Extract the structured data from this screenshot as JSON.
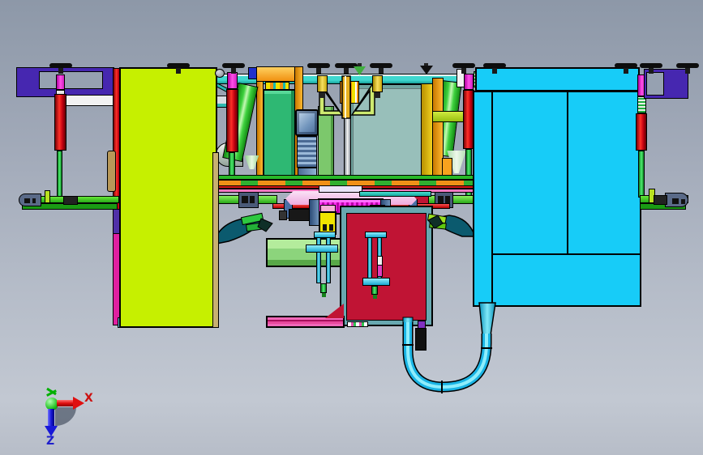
{
  "app": {
    "type": "cad-viewport",
    "view": "orthographic front view of a packaging / handling machine assembly"
  },
  "axis_triad": {
    "x_label": "X",
    "z_label": "Z"
  },
  "palette": {
    "bgTop": "#8d98a8",
    "bgBottom": "#c2c8d2",
    "notch": "#96a1b1",
    "chartreuse": "#c6f000",
    "cyan": "#17ccf8",
    "indigo": "#4627b0",
    "purpleStrip": "#5030a8",
    "magentaStrip": "#e020a0",
    "crimson": "#c01434",
    "tealPanel": "#98bfba",
    "tealFrame": "#68a8b0",
    "drumMagenta": "#e020d0",
    "red": "#e01018",
    "green": "#2eb873",
    "lightGreenPanel": "#7cc86c",
    "orange": "#f8a21e",
    "yellow": "#f0e400",
    "gold": "#d8c018",
    "gusset": "#cde96f",
    "slate": "#5a6a88",
    "steelBlue": "#6f93bb",
    "steelDark": "#4a6fa5",
    "pinkPlate": "#f2c4ea",
    "pinkRail": "#e8489c",
    "tan": "#c8b070",
    "tanDark": "#b89858",
    "hose": "#1ab4e4",
    "darkTealArm": "#0b5a6e",
    "fingerGreen": "#2ec840",
    "fingerLime": "#9ae020",
    "white": "#f2f2f2",
    "axisRed": "#cc1010",
    "axisBlue": "#2020cc",
    "axisGreen": "#00b000"
  }
}
